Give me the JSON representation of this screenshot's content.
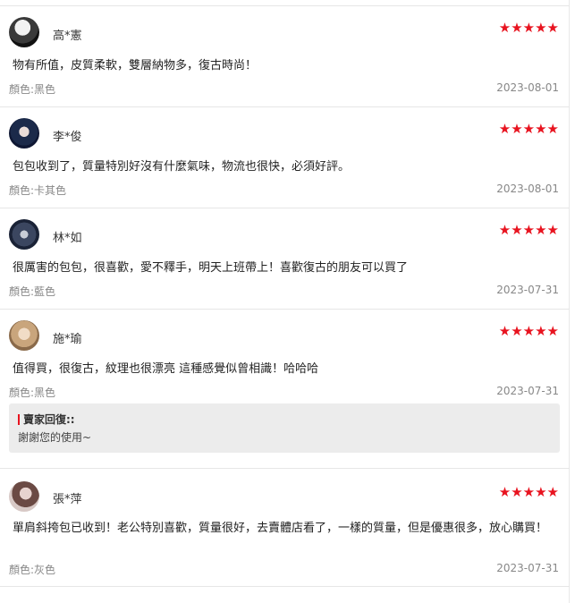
{
  "colors": {
    "star": "#e8131f",
    "reply_bg": "#ececec"
  },
  "reviews": [
    {
      "name": "高*憲",
      "stars": "★★★★★",
      "content": "物有所值，皮質柔軟，雙層納物多，復古時尚！",
      "color": "顏色:黑色",
      "date": "2023-08-01"
    },
    {
      "name": "李*俊",
      "stars": "★★★★★",
      "content": "包包收到了，質量特別好沒有什麼氣味，物流也很快，必須好評。",
      "color": "顏色:卡其色",
      "date": "2023-08-01"
    },
    {
      "name": "林*如",
      "stars": "★★★★★",
      "content": "很厲害的包包，很喜歡，愛不釋手，明天上班帶上！喜歡復古的朋友可以買了",
      "color": "顏色:藍色",
      "date": "2023-07-31"
    },
    {
      "name": "施*瑜",
      "stars": "★★★★★",
      "content": "值得買，很復古，紋理也很漂亮 這種感覺似曾相識！哈哈哈",
      "color": "顏色:黑色",
      "date": "2023-07-31",
      "reply": {
        "title": "賣家回復::",
        "text": "謝謝您的使用~"
      }
    },
    {
      "name": "張*萍",
      "stars": "★★★★★",
      "content": "單肩斜挎包已收到！老公特別喜歡，質量很好，去賣體店看了，一樣的質量，但是優惠很多，放心購買！",
      "color": "顏色:灰色",
      "date": "2023-07-31"
    }
  ]
}
